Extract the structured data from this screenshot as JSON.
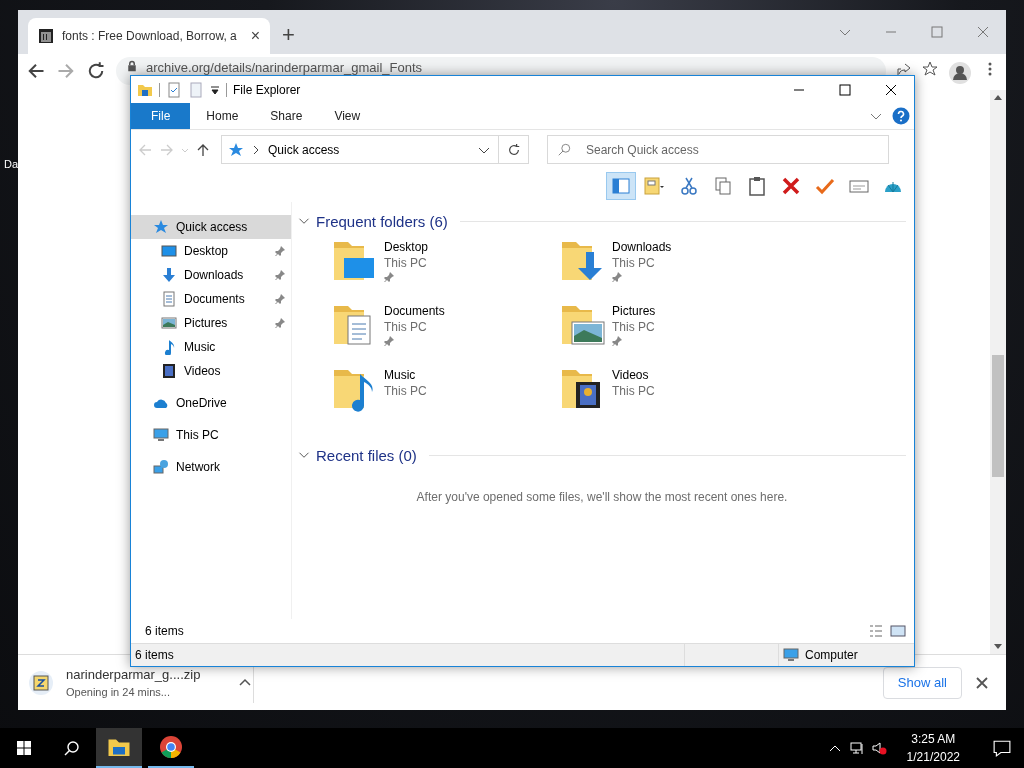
{
  "desktop": {
    "icon_label": "Da"
  },
  "browser": {
    "tab": {
      "title": "fonts : Free Download, Borrow, a",
      "close": "×"
    },
    "new_tab": "+",
    "address": "archive.org/details/narinderparmar_gmail_Fonts",
    "download": {
      "filename": "narinderparmar_g....zip",
      "status": "Opening in 24 mins..."
    },
    "show_all": "Show all"
  },
  "explorer": {
    "title": "File Explorer",
    "ribbon_tabs": [
      {
        "label": "File",
        "kind": "menu"
      },
      {
        "label": "Home",
        "kind": "tab"
      },
      {
        "label": "Share",
        "kind": "tab"
      },
      {
        "label": "View",
        "kind": "tab"
      }
    ],
    "address": "Quick access",
    "search": {
      "placeholder": "Search Quick access"
    },
    "toolbar_buttons": [
      {
        "selected": true
      },
      {
        "selected": false
      },
      {
        "selected": false
      },
      {
        "selected": false
      },
      {
        "selected": false
      },
      {
        "selected": false
      },
      {
        "selected": false
      },
      {
        "selected": false
      },
      {
        "selected": false
      }
    ],
    "sidebar": {
      "items": [
        {
          "label": "Quick access",
          "selected": true,
          "children": [
            {
              "label": "Desktop",
              "pinned": true,
              "selected": false
            },
            {
              "label": "Downloads",
              "pinned": true,
              "selected": false
            },
            {
              "label": "Documents",
              "pinned": true,
              "selected": false
            },
            {
              "label": "Pictures",
              "pinned": true,
              "selected": false
            },
            {
              "label": "Music",
              "pinned": false,
              "selected": false
            },
            {
              "label": "Videos",
              "pinned": false,
              "selected": false
            }
          ]
        },
        {
          "label": "OneDrive",
          "selected": false
        },
        {
          "label": "This PC",
          "selected": false
        },
        {
          "label": "Network",
          "selected": false
        }
      ]
    },
    "frequent": {
      "title": "Frequent folders (6)",
      "folders": [
        {
          "name": "Desktop",
          "location": "This PC",
          "pinned": true
        },
        {
          "name": "Downloads",
          "location": "This PC",
          "pinned": true
        },
        {
          "name": "Documents",
          "location": "This PC",
          "pinned": true
        },
        {
          "name": "Pictures",
          "location": "This PC",
          "pinned": true
        },
        {
          "name": "Music",
          "location": "This PC",
          "pinned": false
        },
        {
          "name": "Videos",
          "location": "This PC",
          "pinned": false
        }
      ]
    },
    "recent": {
      "title": "Recent files (0)",
      "message": "After you've opened some files, we'll show the most recent ones here."
    },
    "item_count": "6 items",
    "status_bar": {
      "count": "6 items",
      "location": "Computer"
    }
  },
  "taskbar": {
    "time": "3:25 AM",
    "date": "1/21/2022"
  }
}
